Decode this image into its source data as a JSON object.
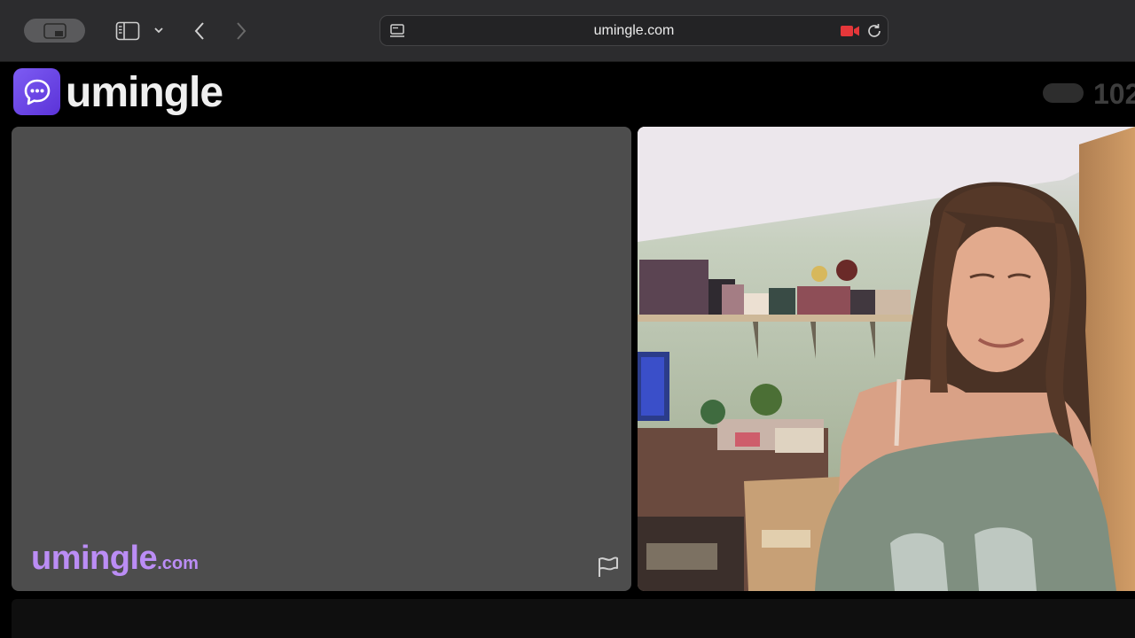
{
  "browser": {
    "url": "umingle.com"
  },
  "site": {
    "logo_text": "umingle",
    "online_count": "102",
    "watermark_main": "umingle",
    "watermark_domain": ".com"
  },
  "colors": {
    "brand": "#6c45e8",
    "watermark": "#bb8df5",
    "camera_indicator": "#e5373a"
  }
}
